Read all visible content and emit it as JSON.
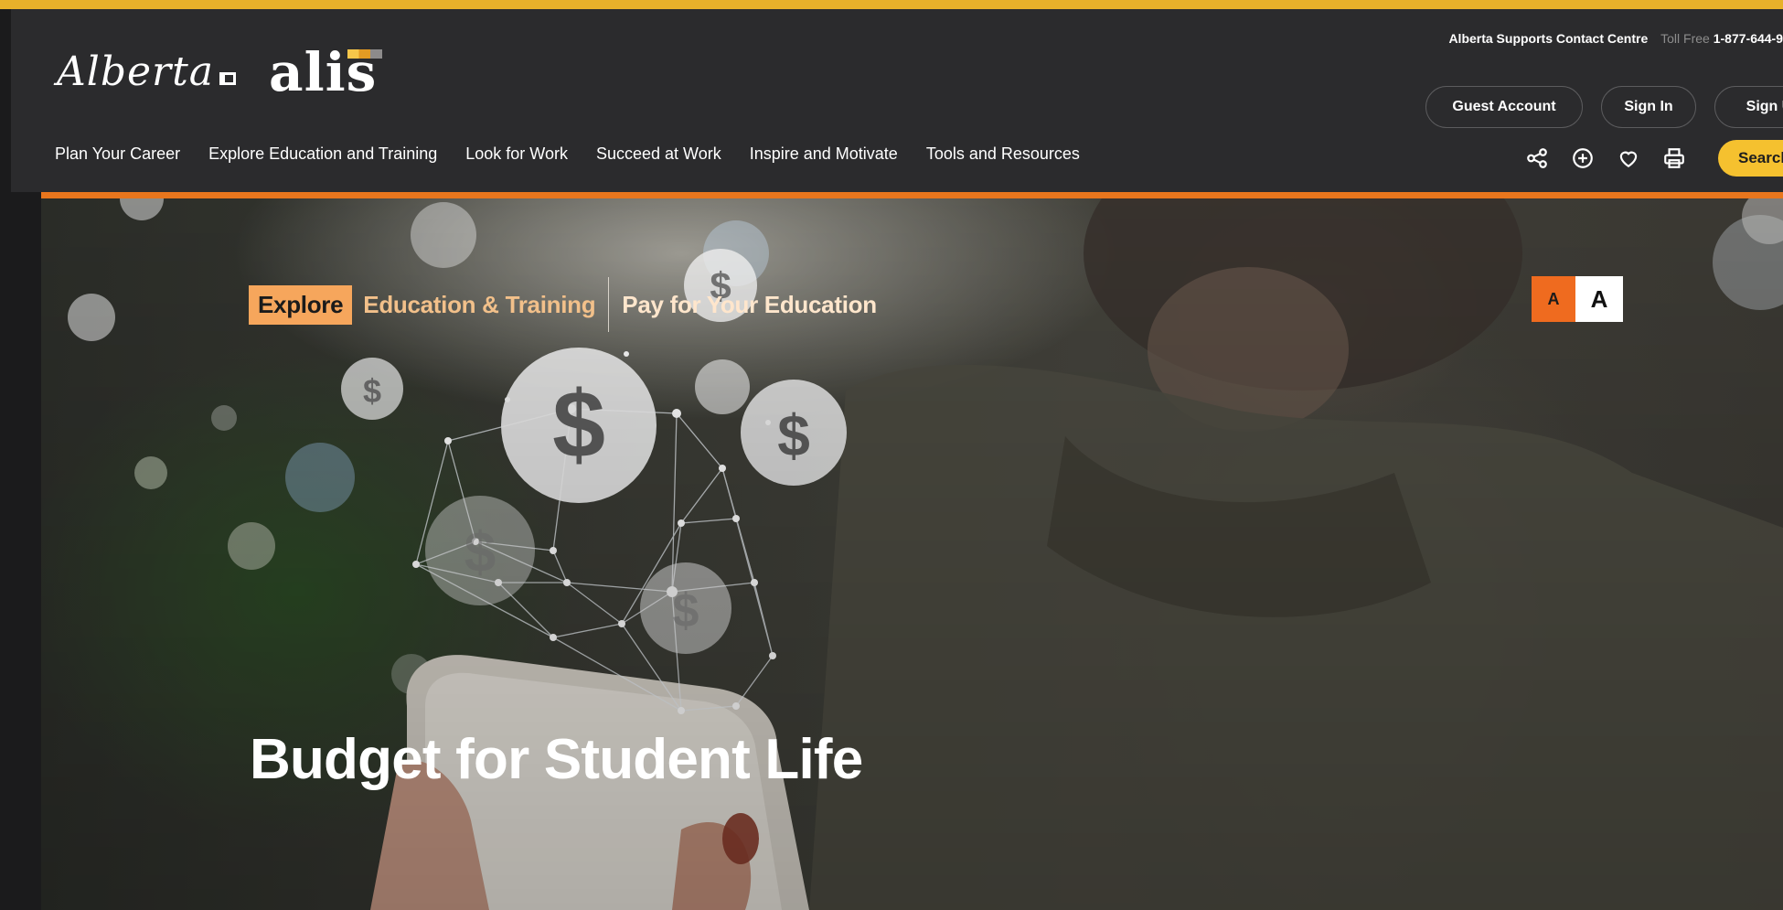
{
  "header": {
    "logos": {
      "alberta": "Alberta",
      "alis": "alis"
    },
    "contact": {
      "label": "Alberta Supports Contact Centre",
      "toll_free_label": "Toll Free",
      "phone": "1-877-644-9"
    },
    "account_buttons": {
      "guest": "Guest Account",
      "sign_in": "Sign In",
      "sign_up": "Sign U"
    },
    "nav": [
      "Plan Your Career",
      "Explore Education and Training",
      "Look for Work",
      "Succeed at Work",
      "Inspire and Motivate",
      "Tools and Resources"
    ],
    "tools": {
      "icons": [
        "share-icon",
        "add-circle-icon",
        "heart-icon",
        "print-icon"
      ],
      "search_label": "Search"
    }
  },
  "hero": {
    "breadcrumb": {
      "explore": "Explore",
      "items": [
        "Education & Training",
        "Pay for Your Education"
      ]
    },
    "text_size": {
      "small": "A",
      "large": "A"
    },
    "title": "Budget for Student Life",
    "image": {
      "icons": [
        "dollar-icon",
        "network-icon"
      ]
    }
  },
  "colors": {
    "header_bg": "#2b2b2d",
    "accent_yellow": "#f5c12f",
    "accent_orange": "#e8761d",
    "explore_bg": "#f6a65c",
    "crumb_text": "#f2c08a"
  }
}
